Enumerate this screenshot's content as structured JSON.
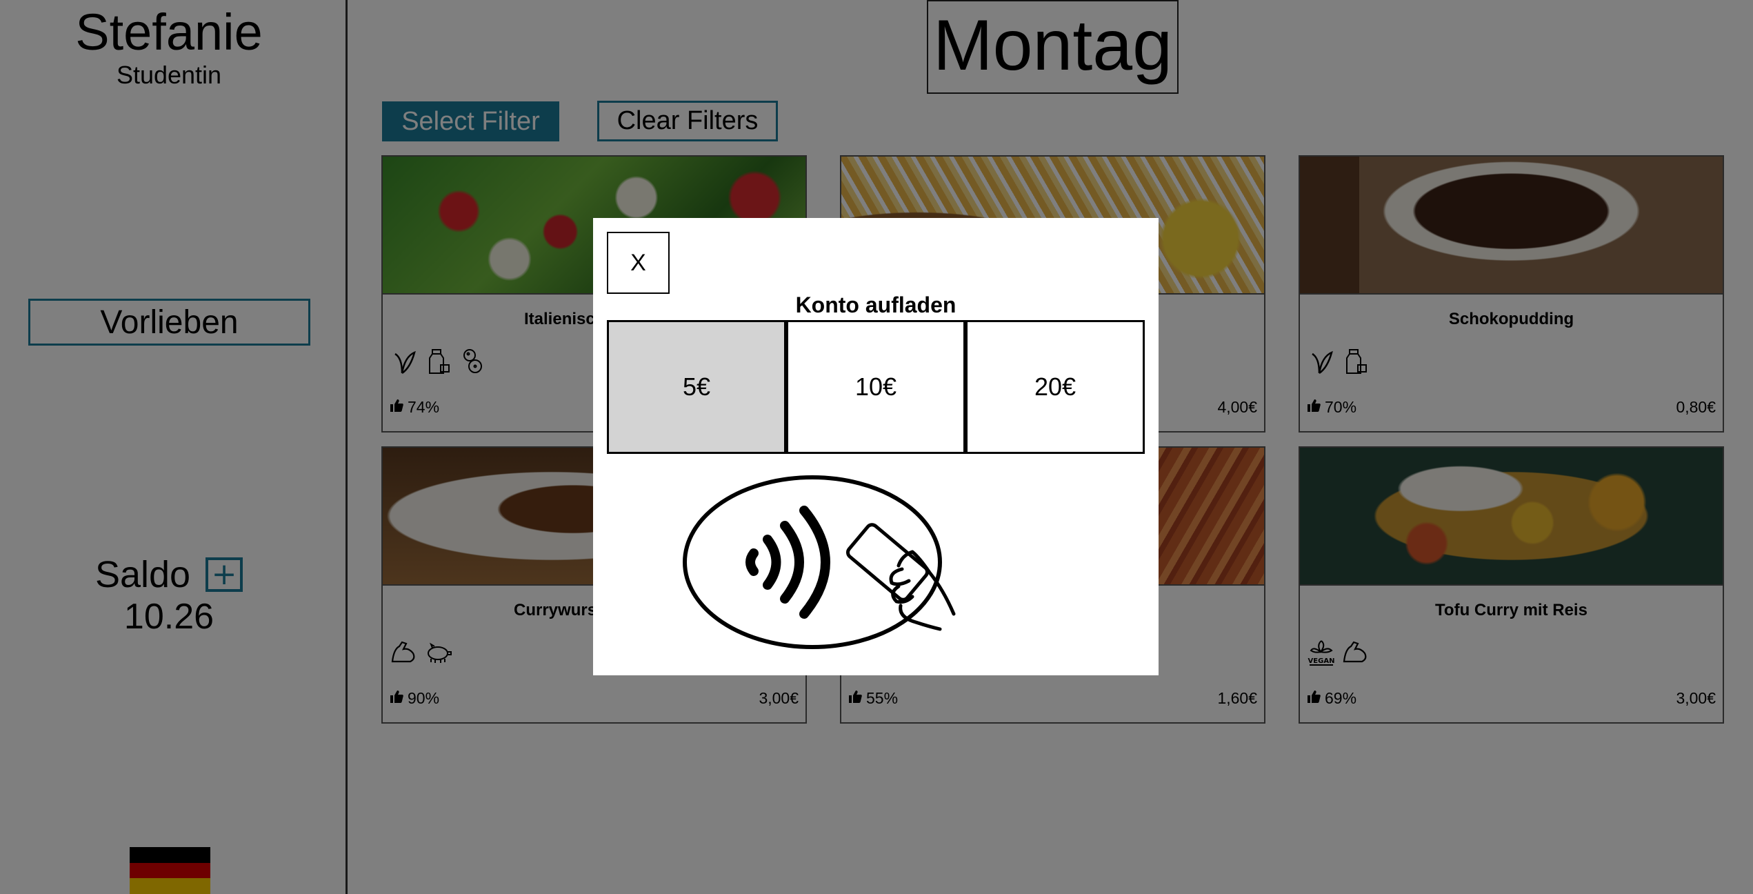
{
  "user": {
    "name": "Stefanie",
    "role": "Studentin"
  },
  "sidebar": {
    "preferences_label": "Vorlieben",
    "balance_label": "Saldo",
    "balance_add": "+",
    "balance_value": "10.26"
  },
  "header": {
    "day": "Montag"
  },
  "filters": {
    "select_label": "Select Filter",
    "clear_label": "Clear Filters"
  },
  "meals": [
    {
      "name": "Italienisc",
      "rating": "74%",
      "price": "",
      "icons": [
        "vegetarian-leaf-icon",
        "milk-icon",
        "peanut-icon"
      ]
    },
    {
      "name": "",
      "rating": "",
      "price": "4,00€",
      "icons": []
    },
    {
      "name": "Schokopudding",
      "rating": "70%",
      "price": "0,80€",
      "icons": [
        "vegetarian-leaf-icon",
        "milk-icon"
      ]
    },
    {
      "name": "Currywurs",
      "rating": "90%",
      "price": "3,00€",
      "icons": [
        "muscle-protein-icon",
        "pig-icon"
      ]
    },
    {
      "name": "",
      "rating": "55%",
      "price": "1,60€",
      "icons": []
    },
    {
      "name": "Tofu Curry mit Reis",
      "rating": "69%",
      "price": "3,00€",
      "icons": [
        "vegan-icon",
        "muscle-protein-icon"
      ]
    }
  ],
  "modal": {
    "close_label": "X",
    "title": "Konto aufladen",
    "amounts": [
      "5€",
      "10€",
      "20€"
    ],
    "selected_amount": "5€"
  },
  "colors": {
    "accent": "#1b7a99",
    "overlay": "rgba(0,0,0,0.5)",
    "selected": "#d3d3d3"
  },
  "language_flag": "germany-flag-icon"
}
